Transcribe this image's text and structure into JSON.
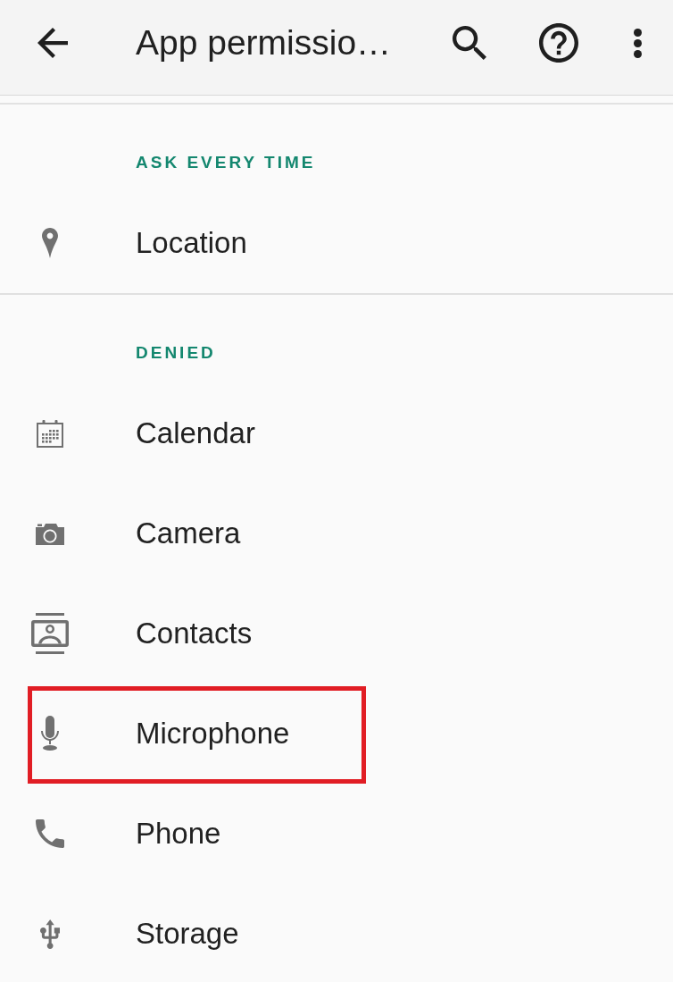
{
  "toolbar": {
    "title": "App permissio…"
  },
  "sections": [
    {
      "header": "ASK EVERY TIME",
      "items": [
        {
          "label": "Location",
          "kind": "location",
          "highlighted": false
        }
      ]
    },
    {
      "header": "DENIED",
      "items": [
        {
          "label": "Calendar",
          "kind": "calendar",
          "highlighted": false
        },
        {
          "label": "Camera",
          "kind": "camera",
          "highlighted": false
        },
        {
          "label": "Contacts",
          "kind": "contacts",
          "highlighted": false
        },
        {
          "label": "Microphone",
          "kind": "microphone",
          "highlighted": true
        },
        {
          "label": "Phone",
          "kind": "phone",
          "highlighted": false
        },
        {
          "label": "Storage",
          "kind": "storage",
          "highlighted": false
        }
      ]
    }
  ]
}
